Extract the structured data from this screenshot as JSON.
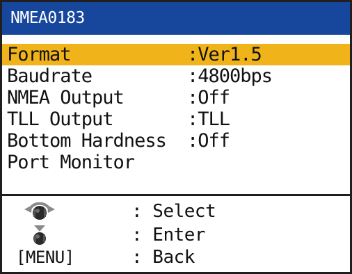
{
  "title": "NMEA0183",
  "menu": {
    "items": [
      {
        "label": "Format",
        "value": ":Ver1.5",
        "selected": true
      },
      {
        "label": "Baudrate",
        "value": ":4800bps",
        "selected": false
      },
      {
        "label": "NMEA Output",
        "value": ":Off",
        "selected": false
      },
      {
        "label": "TLL Output",
        "value": ":TLL",
        "selected": false
      },
      {
        "label": "Bottom Hardness",
        "value": ":Off",
        "selected": false
      },
      {
        "label": "Port Monitor",
        "value": "",
        "selected": false
      }
    ]
  },
  "guide": {
    "select": {
      "icon": "rotary-knob-rotate-icon",
      "text": ": Select"
    },
    "enter": {
      "icon": "rotary-knob-push-icon",
      "text": ": Enter"
    },
    "back": {
      "key": "[MENU]",
      "text": ": Back"
    }
  },
  "colors": {
    "title_bg": "#16479c",
    "title_text": "#ffffff",
    "selected_bg": "#f0b31a",
    "text": "#111111",
    "border": "#1f1f1f"
  }
}
